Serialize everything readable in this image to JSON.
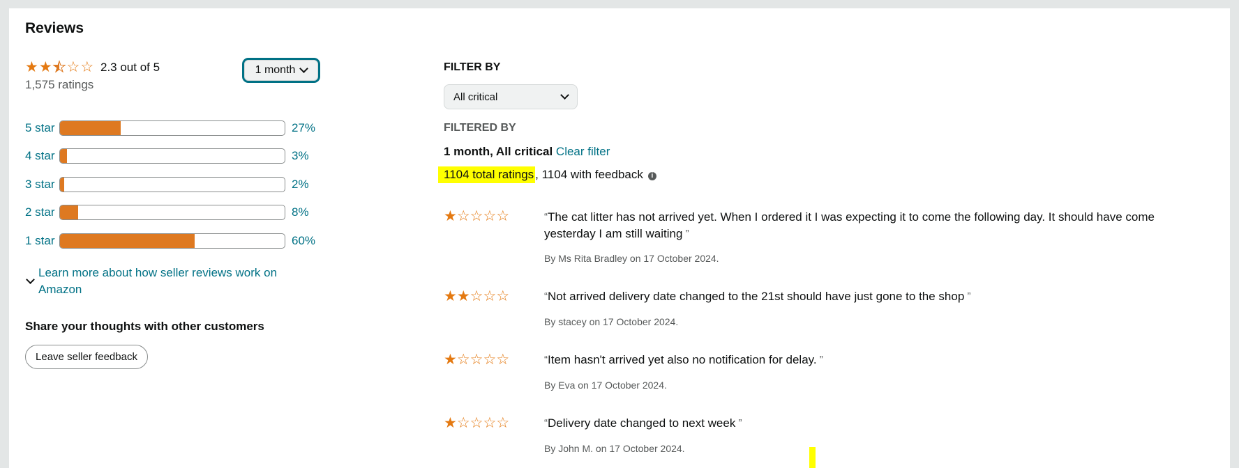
{
  "title": "Reviews",
  "summary": {
    "rating_value": 2.3,
    "stars": [
      "full",
      "full",
      "half",
      "empty",
      "empty"
    ],
    "avg_text": "2.3 out of  5",
    "total_ratings": "1,575 ratings",
    "period_label": "1 month"
  },
  "histogram": [
    {
      "label": "5 star",
      "pct_text": "27%",
      "pct": 27
    },
    {
      "label": "4 star",
      "pct_text": "3%",
      "pct": 3
    },
    {
      "label": "3 star",
      "pct_text": "2%",
      "pct": 2
    },
    {
      "label": "2 star",
      "pct_text": "8%",
      "pct": 8
    },
    {
      "label": "1 star",
      "pct_text": "60%",
      "pct": 60
    }
  ],
  "learn_more": "Learn more about how seller reviews work on Amazon",
  "share_title": "Share your thoughts with other customers",
  "leave_button": "Leave seller feedback",
  "filter": {
    "filter_by_label": "FILTER BY",
    "selected": "All critical",
    "filtered_by_label": "FILTERED BY",
    "applied": "1 month, All critical",
    "clear_label": "Clear filter",
    "total_ratings": "1104 total ratings",
    "with_feedback": ", 1104 with feedback"
  },
  "reviews": [
    {
      "stars": 1,
      "text": "The cat litter has not arrived yet. When I ordered it I was expecting it to come the following day. It should have come yesterday I am still waiting",
      "by": "By Ms Rita Bradley on 17 October 2024."
    },
    {
      "stars": 2,
      "text": "Not arrived delivery date changed to the 21st should have just gone to the shop",
      "by": "By stacey on 17 October 2024."
    },
    {
      "stars": 1,
      "text": "Item hasn't arrived yet also no notification for delay.",
      "by": "By Eva on 17 October 2024."
    },
    {
      "stars": 1,
      "text": "Delivery date changed to next week",
      "by": "By John M. on 17 October 2024."
    }
  ],
  "colors": {
    "star": "#de7921",
    "link": "#007185",
    "highlight": "#ffff00"
  }
}
